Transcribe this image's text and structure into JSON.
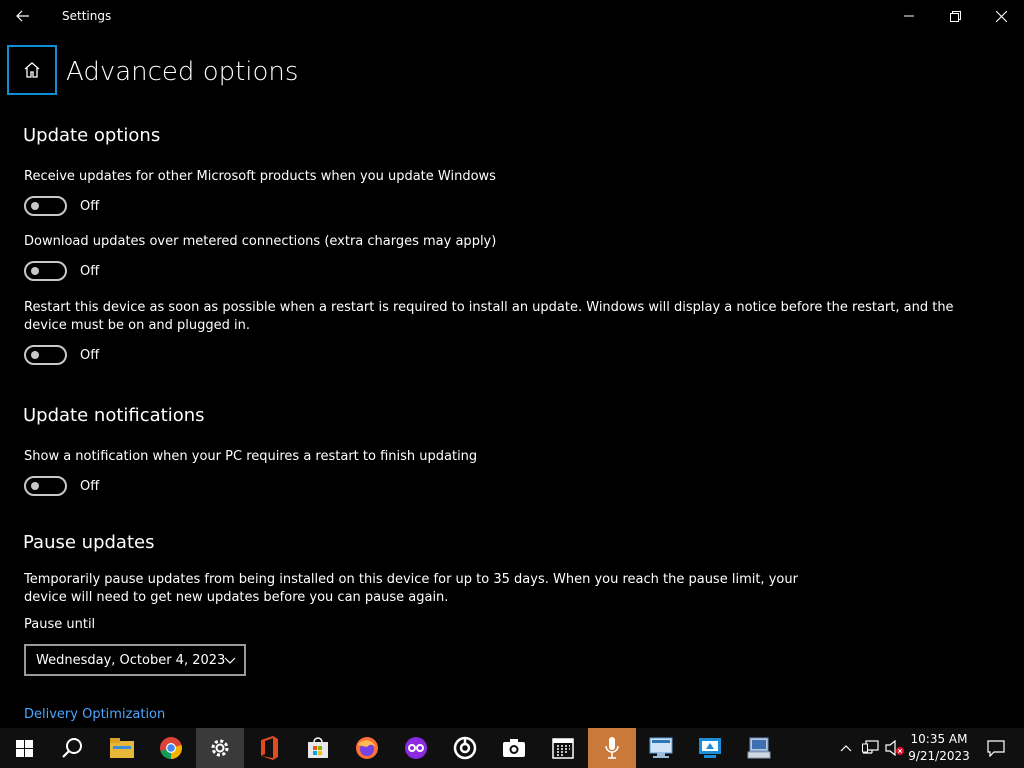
{
  "window": {
    "title": "Settings",
    "back_icon": "back-arrow-icon",
    "minimize_icon": "minimize-icon",
    "restore_icon": "restore-icon",
    "close_icon": "close-icon"
  },
  "page": {
    "home_icon": "home-icon",
    "title": "Advanced options"
  },
  "update_options": {
    "title": "Update options",
    "items": [
      {
        "label": "Receive updates for other Microsoft products when you update Windows",
        "state": "Off"
      },
      {
        "label": "Download updates over metered connections (extra charges may apply)",
        "state": "Off"
      },
      {
        "label": "Restart this device as soon as possible when a restart is required to install an update. Windows will display a notice before the restart, and the device must be on and plugged in.",
        "state": "Off"
      }
    ]
  },
  "update_notifications": {
    "title": "Update notifications",
    "items": [
      {
        "label": "Show a notification when your PC requires a restart to finish updating",
        "state": "Off"
      }
    ]
  },
  "pause_updates": {
    "title": "Pause updates",
    "description": "Temporarily pause updates from being installed on this device for up to 35 days. When you reach the pause limit, your device will need to get new updates before you can pause again.",
    "pause_until_label": "Pause until",
    "selected_date": "Wednesday, October 4, 2023"
  },
  "links": {
    "delivery_optimization": "Delivery Optimization"
  },
  "taskbar": {
    "items": [
      "windows-start-icon",
      "search-icon",
      "file-explorer-icon",
      "chrome-icon",
      "settings-icon",
      "office-icon",
      "store-icon",
      "firefox-icon",
      "vr-app-icon",
      "media-app-icon",
      "camera-icon",
      "calendar-icon",
      "microphone-icon",
      "network-app-icon",
      "remote-desktop-icon",
      "computer-app-icon"
    ],
    "tray": [
      "chevron-up-icon",
      "network-icon",
      "volume-muted-icon"
    ],
    "time": "10:35 AM",
    "date": "9/21/2023",
    "notifications_icon": "notifications-icon"
  },
  "colors": {
    "accent": "#0f8ed6",
    "link": "#4da6ff",
    "background": "#000000",
    "taskbar": "#101010"
  }
}
